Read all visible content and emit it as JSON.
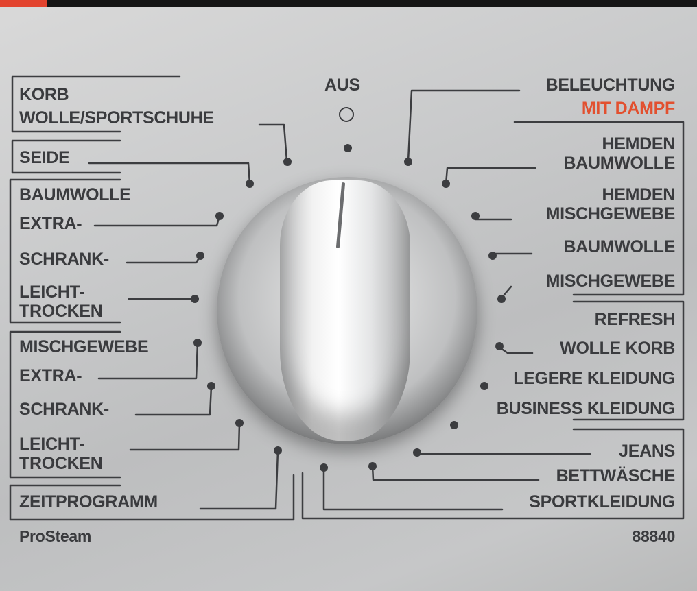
{
  "colors": {
    "accent": "#e2432e",
    "text": "#3a3b3e",
    "highlight": "#e2502f"
  },
  "dial": {
    "off_label": "AUS",
    "off_icon": "circle-icon"
  },
  "left_programs": [
    {
      "id": "korb",
      "lines": [
        "KORB",
        "WOLLE/SPORTSCHUHE"
      ]
    },
    {
      "id": "seide",
      "lines": [
        "SEIDE"
      ]
    },
    {
      "id": "baumwolle",
      "lines": [
        "BAUMWOLLE"
      ]
    },
    {
      "id": "bw-extra",
      "lines": [
        "EXTRA-"
      ]
    },
    {
      "id": "bw-schrank",
      "lines": [
        "SCHRANK-"
      ]
    },
    {
      "id": "bw-leicht",
      "lines": [
        "LEICHT-",
        "TROCKEN"
      ]
    },
    {
      "id": "mischgewebe",
      "lines": [
        "MISCHGEWEBE"
      ]
    },
    {
      "id": "mg-extra",
      "lines": [
        "EXTRA-"
      ]
    },
    {
      "id": "mg-schrank",
      "lines": [
        "SCHRANK-"
      ]
    },
    {
      "id": "mg-leicht",
      "lines": [
        "LEICHT-",
        "TROCKEN"
      ]
    },
    {
      "id": "zeitprogramm",
      "lines": [
        "ZEITPROGRAMM"
      ]
    }
  ],
  "right_programs": [
    {
      "id": "beleuchtung",
      "lines": [
        "BELEUCHTUNG"
      ]
    },
    {
      "id": "mit-dampf",
      "lines": [
        "MIT DAMPF"
      ]
    },
    {
      "id": "hemden-bw",
      "lines": [
        "HEMDEN",
        "BAUMWOLLE"
      ]
    },
    {
      "id": "hemden-mg",
      "lines": [
        "HEMDEN",
        "MISCHGEWEBE"
      ]
    },
    {
      "id": "baumwolle",
      "lines": [
        "BAUMWOLLE"
      ]
    },
    {
      "id": "mischgewebe",
      "lines": [
        "MISCHGEWEBE"
      ]
    },
    {
      "id": "refresh",
      "lines": [
        "REFRESH"
      ]
    },
    {
      "id": "wolle-korb",
      "lines": [
        "WOLLE KORB"
      ]
    },
    {
      "id": "legere",
      "lines": [
        "LEGERE KLEIDUNG"
      ]
    },
    {
      "id": "business",
      "lines": [
        "BUSINESS KLEIDUNG"
      ]
    },
    {
      "id": "jeans",
      "lines": [
        "JEANS"
      ]
    },
    {
      "id": "bettwaesche",
      "lines": [
        "BETTWÄSCHE"
      ]
    },
    {
      "id": "sportkleidung",
      "lines": [
        "SPORTKLEIDUNG"
      ]
    }
  ],
  "footer": {
    "brand": "ProSteam",
    "model": "88840"
  }
}
